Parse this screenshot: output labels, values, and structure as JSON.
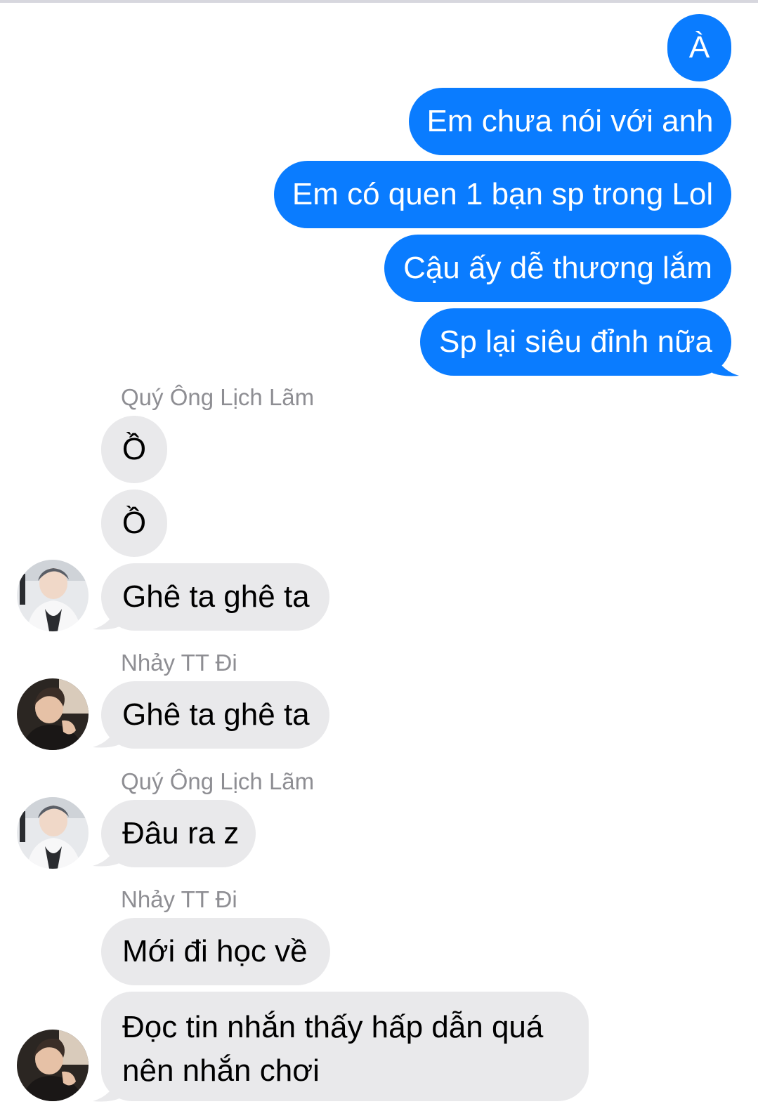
{
  "conversation": {
    "outgoing": [
      "À",
      "Em chưa nói với anh",
      "Em có quen 1 bạn sp trong Lol",
      "Cậu ấy dễ thương lắm",
      "Sp lại siêu đỉnh nữa"
    ],
    "incoming": [
      {
        "sender": "Quý Ông Lịch Lãm",
        "messages": [
          "Ồ",
          "Ồ",
          "Ghê ta ghê ta"
        ]
      },
      {
        "sender": "Nhảy TT Đi",
        "messages": [
          "Ghê ta ghê ta"
        ]
      },
      {
        "sender": "Quý Ông Lịch Lãm",
        "messages": [
          "Đâu ra z"
        ]
      },
      {
        "sender": "Nhảy TT Đi",
        "messages": [
          "Mới đi học về",
          "Đọc tin nhắn thấy hấp dẫn quá nên nhắn chơi"
        ]
      }
    ]
  },
  "colors": {
    "outgoing_bubble": "#0a7cff",
    "incoming_bubble": "#e9e9eb",
    "sender_name": "#8e8e93"
  },
  "avatars": {
    "quy_ong_lich_lam": "profile-photo-light",
    "nhay_tt_di": "profile-photo-dark"
  }
}
